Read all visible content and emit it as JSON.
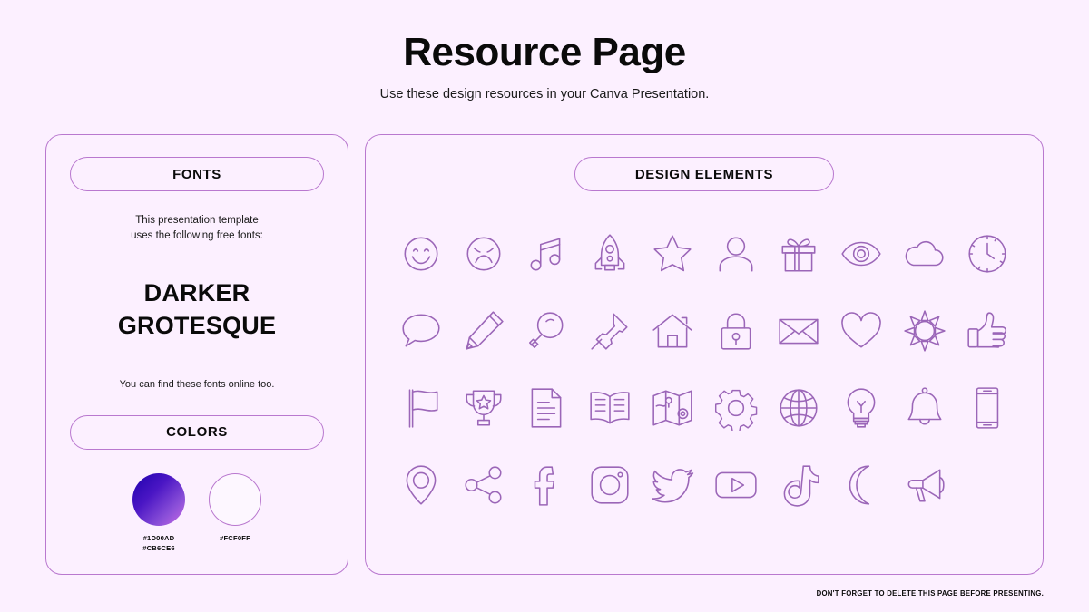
{
  "header": {
    "title": "Resource Page",
    "subtitle": "Use these design resources in your Canva Presentation."
  },
  "fonts_panel": {
    "heading": "FONTS",
    "description": "This presentation template\nuses the following free fonts:",
    "font_name": "DARKER\nGROTESQUE",
    "note": "You can find these fonts online too.",
    "colors_heading": "COLORS",
    "swatches": [
      {
        "name": "gradient-swatch",
        "label": "#1D00AD\n#CB6CE6",
        "from": "#1D00AD",
        "to": "#CB6CE6"
      },
      {
        "name": "background-swatch",
        "label": "#FCF0FF",
        "from": "#FCF0FF",
        "to": "#FCF0FF"
      }
    ]
  },
  "elements_panel": {
    "heading": "DESIGN ELEMENTS",
    "icons": [
      "smiley-face-icon",
      "sad-face-icon",
      "music-note-icon",
      "rocket-icon",
      "star-icon",
      "person-icon",
      "gift-icon",
      "eye-icon",
      "cloud-icon",
      "clock-icon",
      "speech-bubble-icon",
      "pencil-icon",
      "magnifier-icon",
      "pushpin-icon",
      "house-icon",
      "lock-icon",
      "envelope-icon",
      "heart-icon",
      "sun-icon",
      "thumbs-up-icon",
      "flag-icon",
      "trophy-icon",
      "document-icon",
      "book-icon",
      "map-icon",
      "gear-icon",
      "globe-icon",
      "lightbulb-icon",
      "bell-icon",
      "phone-icon",
      "location-pin-icon",
      "share-icon",
      "facebook-icon",
      "instagram-icon",
      "twitter-icon",
      "youtube-icon",
      "tiktok-icon",
      "moon-icon",
      "megaphone-icon"
    ]
  },
  "footer": {
    "note": "DON'T FORGET TO DELETE THIS PAGE BEFORE PRESENTING."
  },
  "theme": {
    "background": "#FCF0FF",
    "border": "#B978CF",
    "icon_stroke": "#9B66B8",
    "text": "#0A0A0A"
  }
}
